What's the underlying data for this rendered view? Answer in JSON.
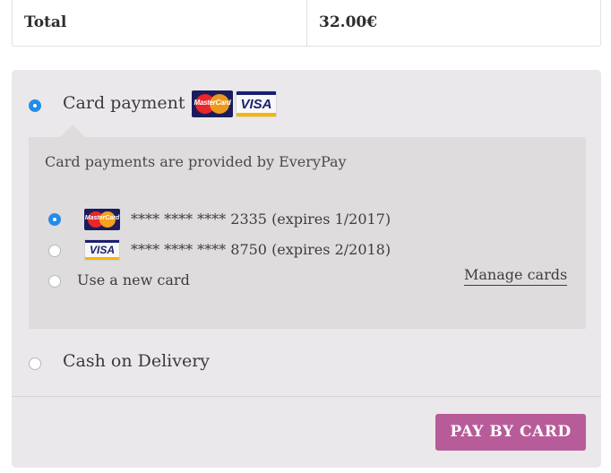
{
  "order_totals": {
    "label": "Total",
    "value": "32.00€"
  },
  "payment_methods": {
    "card": {
      "label": "Card payment",
      "selected": true,
      "logos": [
        {
          "name": "mastercard-logo",
          "text": "MasterCard"
        },
        {
          "name": "visa-logo",
          "text": "VISA"
        }
      ],
      "description": "Card payments are provided by EveryPay",
      "saved_cards": [
        {
          "brand": "MasterCard",
          "text": "**** **** **** 2335 (expires 1/2017)",
          "selected": true
        },
        {
          "brand": "VISA",
          "text": "**** **** **** 8750 (expires 2/2018)",
          "selected": false
        }
      ],
      "new_card_label": "Use a new card",
      "manage_cards_label": "Manage cards"
    },
    "cod": {
      "label": "Cash on Delivery",
      "selected": false
    }
  },
  "submit": {
    "label": "PAY BY CARD",
    "color": "#b85c99"
  },
  "colors": {
    "radio_selected": "#1e8cf0",
    "panel_bg": "#ebe8eb",
    "inner_box_bg": "#dfdcde"
  }
}
